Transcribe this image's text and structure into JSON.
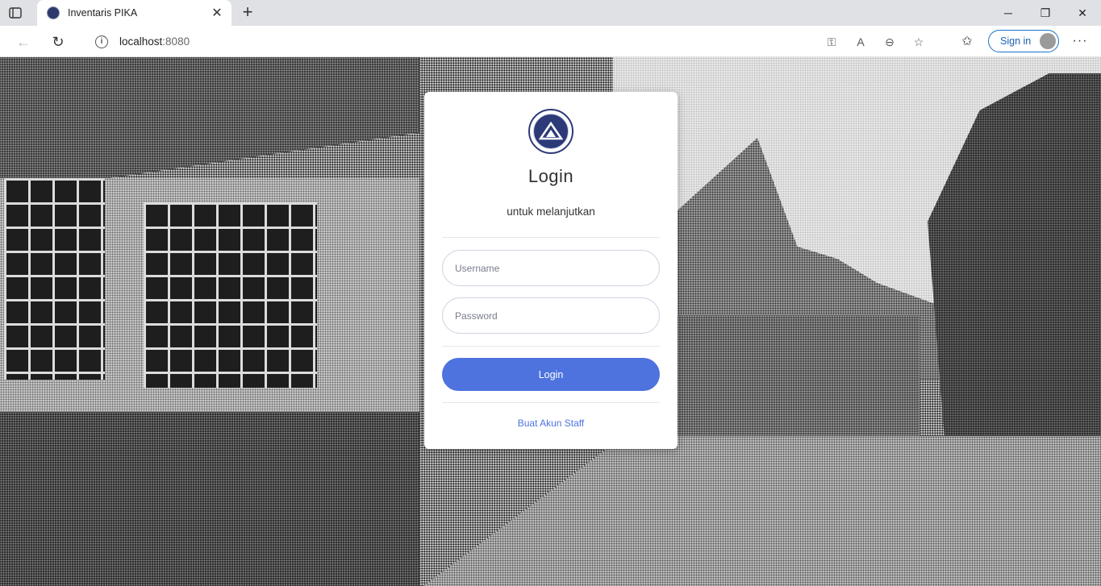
{
  "browser": {
    "tab_title": "Inventaris PIKA",
    "new_tab_symbol": "+",
    "url_host": "localhost",
    "url_port": ":8080",
    "signin_label": "Sign in",
    "icons": [
      "tab-actions-icon",
      "favicon-icon",
      "close-tab-icon",
      "new-tab-icon",
      "minimize-icon",
      "maximize-icon",
      "close-window-icon",
      "back-icon",
      "refresh-icon",
      "info-icon",
      "key-icon",
      "read-aloud-icon",
      "zoom-out-icon",
      "add-favorite-icon",
      "favorites-icon",
      "profile-avatar-icon",
      "more-icon"
    ]
  },
  "login": {
    "title": "Login",
    "subtitle": "untuk melanjutkan",
    "username_placeholder": "Username",
    "password_placeholder": "Password",
    "submit_label": "Login",
    "register_link": "Buat Akun Staff"
  },
  "colors": {
    "primary": "#4e73df",
    "logo_navy": "#2d3a78",
    "signin_border": "#1a73c8"
  }
}
